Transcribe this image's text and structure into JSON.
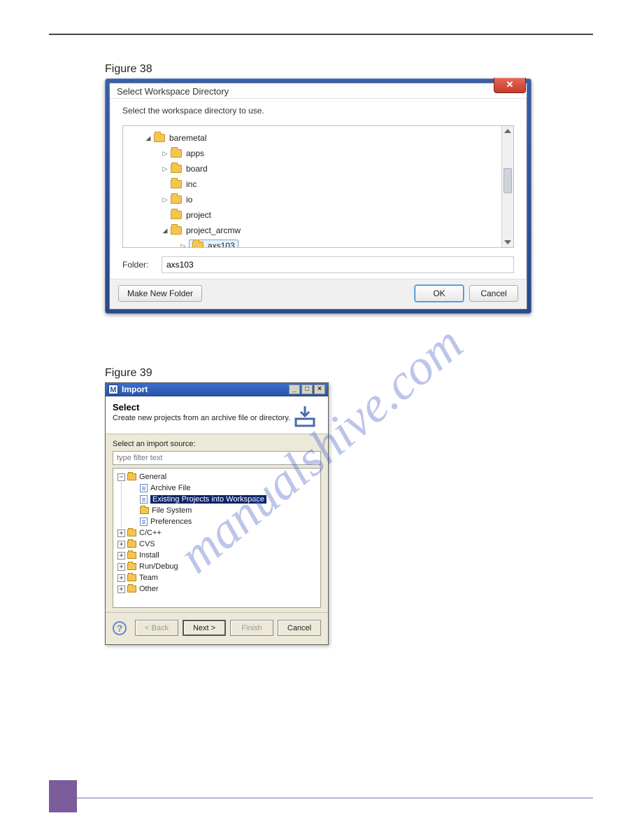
{
  "watermark": "manualshive.com",
  "figure38": {
    "label": "Figure 38",
    "dialog": {
      "title": "Select Workspace Directory",
      "close_glyph": "✕",
      "prompt": "Select the workspace directory to use.",
      "tree": {
        "root": "baremetal",
        "children": [
          "apps",
          "board",
          "inc",
          "io",
          "project",
          "project_arcmw"
        ],
        "grandchild": "axs103"
      },
      "folder_label": "Folder:",
      "folder_value": "axs103",
      "buttons": {
        "make_new": "Make New Folder",
        "ok": "OK",
        "cancel": "Cancel"
      }
    }
  },
  "figure39": {
    "label": "Figure 39",
    "dialog": {
      "title_icon": "M",
      "title": "Import",
      "banner_title": "Select",
      "banner_sub": "Create new projects from an archive file or directory.",
      "source_label": "Select an import source:",
      "filter_placeholder": "type filter text",
      "tree": {
        "general": "General",
        "general_children": [
          "Archive File",
          "Existing Projects into Workspace",
          "File System",
          "Preferences"
        ],
        "others": [
          "C/C++",
          "CVS",
          "Install",
          "Run/Debug",
          "Team",
          "Other"
        ]
      },
      "buttons": {
        "back": "< Back",
        "next": "Next >",
        "finish": "Finish",
        "cancel": "Cancel"
      },
      "window_controls": {
        "min": "_",
        "max": "□",
        "close": "×"
      }
    }
  }
}
